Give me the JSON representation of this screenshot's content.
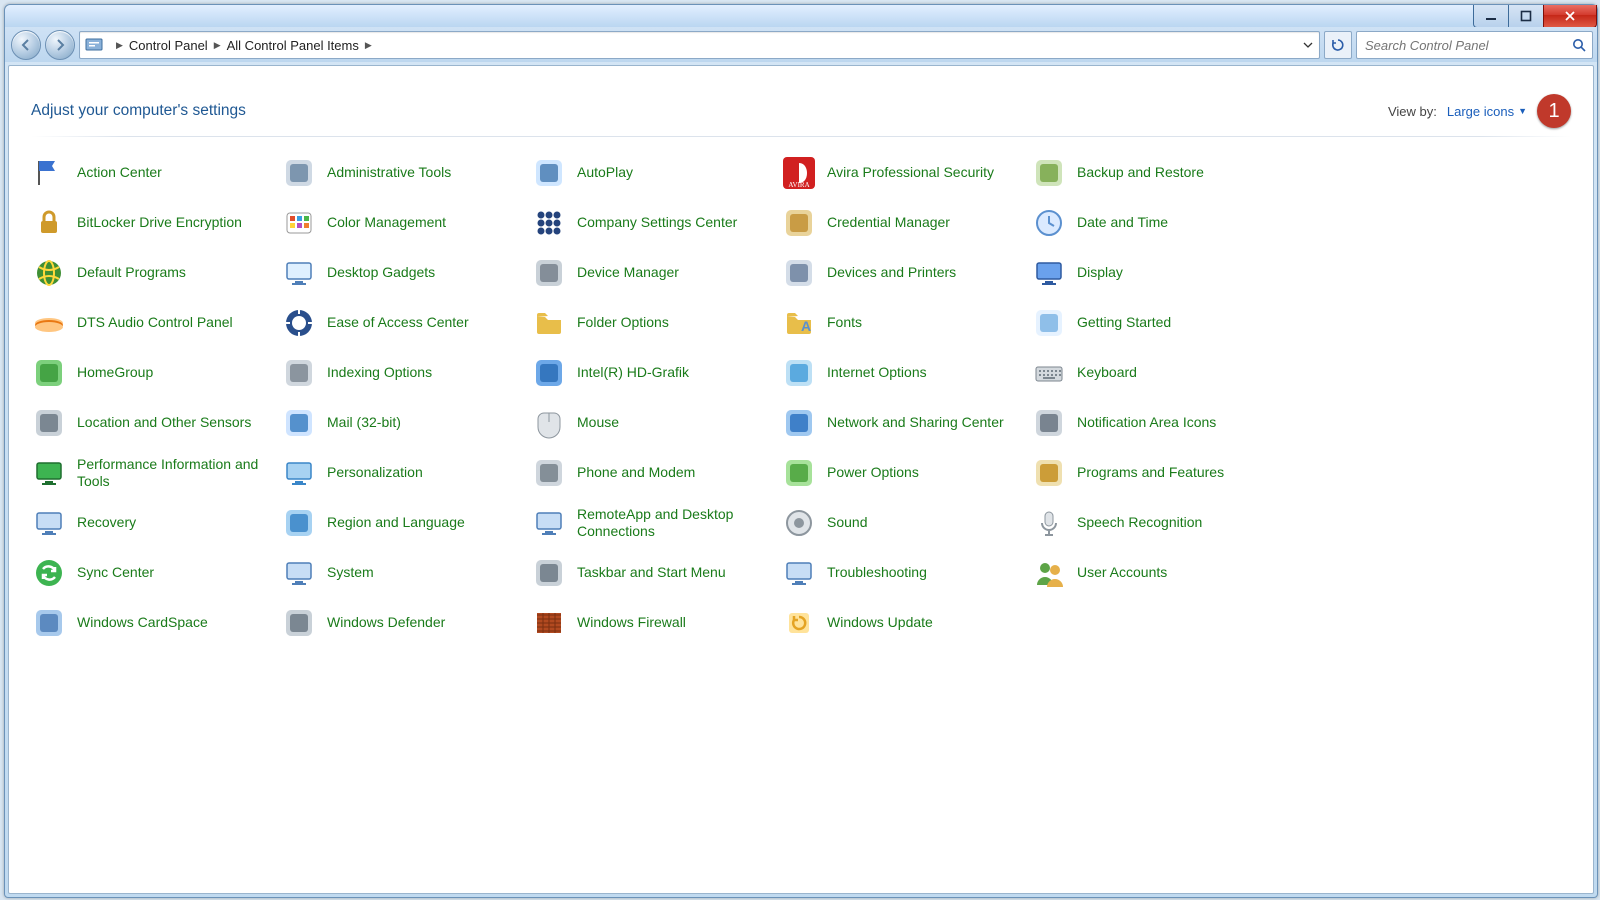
{
  "breadcrumb": {
    "root": "Control Panel",
    "sub": "All Control Panel Items"
  },
  "search": {
    "placeholder": "Search Control Panel"
  },
  "header": {
    "title": "Adjust your computer's settings",
    "viewby_label": "View by:",
    "viewby_value": "Large icons"
  },
  "annotation": {
    "label": "1"
  },
  "items": [
    {
      "label": "Action Center",
      "ic": "flag",
      "c1": "#3a72d0",
      "c2": "#6ba6ff"
    },
    {
      "label": "Administrative Tools",
      "ic": "tools",
      "c1": "#6f8aa6",
      "c2": "#cfd9e4"
    },
    {
      "label": "AutoPlay",
      "ic": "media",
      "c1": "#4c7fb5",
      "c2": "#cfe6ff"
    },
    {
      "label": "Avira Professional Security",
      "ic": "avira",
      "c1": "#d12020",
      "c2": "#ffffff"
    },
    {
      "label": "Backup and Restore",
      "ic": "backup",
      "c1": "#7aa84a",
      "c2": "#cfe4ba"
    },
    {
      "label": "BitLocker Drive Encryption",
      "ic": "lock",
      "c1": "#cf9a2b",
      "c2": "#ffe6a3"
    },
    {
      "label": "Color Management",
      "ic": "color",
      "c1": "#e24d2b",
      "c2": "#ffd43a"
    },
    {
      "label": "Company Settings Center",
      "ic": "dots",
      "c1": "#24437c",
      "c2": "#4b72c0"
    },
    {
      "label": "Credential Manager",
      "ic": "safe",
      "c1": "#c39236",
      "c2": "#e9d39a"
    },
    {
      "label": "Date and Time",
      "ic": "clock",
      "c1": "#5b90cf",
      "c2": "#dbeaff"
    },
    {
      "label": "Default Programs",
      "ic": "globe",
      "c1": "#3f8f34",
      "c2": "#ffd83b"
    },
    {
      "label": "Desktop Gadgets",
      "ic": "monitor",
      "c1": "#4f7fb8",
      "c2": "#dff0ff"
    },
    {
      "label": "Device Manager",
      "ic": "device",
      "c1": "#78838e",
      "c2": "#c9d1d8"
    },
    {
      "label": "Devices and Printers",
      "ic": "printer",
      "c1": "#6f84a0",
      "c2": "#d4dde8"
    },
    {
      "label": "Display",
      "ic": "screen",
      "c1": "#2e5aa0",
      "c2": "#6aa1ec"
    },
    {
      "label": "DTS Audio Control Panel",
      "ic": "dts",
      "c1": "#e97812",
      "c2": "#ffc681"
    },
    {
      "label": "Ease of Access Center",
      "ic": "ease",
      "c1": "#2a4f8c",
      "c2": "#6a9be5"
    },
    {
      "label": "Folder Options",
      "ic": "folder",
      "c1": "#e8be4a",
      "c2": "#fff0c0"
    },
    {
      "label": "Fonts",
      "ic": "fonts",
      "c1": "#e8be4a",
      "c2": "#5b90cf"
    },
    {
      "label": "Getting Started",
      "ic": "start",
      "c1": "#7fb6e5",
      "c2": "#e6f2ff"
    },
    {
      "label": "HomeGroup",
      "ic": "home",
      "c1": "#3c9c3c",
      "c2": "#7cd07c"
    },
    {
      "label": "Indexing Options",
      "ic": "index",
      "c1": "#7f8a94",
      "c2": "#d0d7de"
    },
    {
      "label": "Intel(R) HD-Grafik",
      "ic": "intel",
      "c1": "#2c6fb7",
      "c2": "#6da8e8"
    },
    {
      "label": "Internet Options",
      "ic": "netopt",
      "c1": "#4aa0da",
      "c2": "#bde0f5"
    },
    {
      "label": "Keyboard",
      "ic": "keyboard",
      "c1": "#7c868f",
      "c2": "#d4d9de"
    },
    {
      "label": "Location and Other Sensors",
      "ic": "sensor",
      "c1": "#6d7a86",
      "c2": "#c9d1d8"
    },
    {
      "label": "Mail (32-bit)",
      "ic": "mail",
      "c1": "#3f82c4",
      "c2": "#cfe4ff"
    },
    {
      "label": "Mouse",
      "ic": "mouse",
      "c1": "#8d969e",
      "c2": "#e0e4e8"
    },
    {
      "label": "Network and Sharing Center",
      "ic": "network",
      "c1": "#2e73c2",
      "c2": "#9fc8f0"
    },
    {
      "label": "Notification Area Icons",
      "ic": "notify",
      "c1": "#6a7582",
      "c2": "#cfd6dd"
    },
    {
      "label": "Performance Information and Tools",
      "ic": "perf",
      "c1": "#1e6f2f",
      "c2": "#3db451"
    },
    {
      "label": "Personalization",
      "ic": "pers",
      "c1": "#3a86c8",
      "c2": "#a7d2f2"
    },
    {
      "label": "Phone and Modem",
      "ic": "phone",
      "c1": "#77828c",
      "c2": "#cfd6dd"
    },
    {
      "label": "Power Options",
      "ic": "power",
      "c1": "#4aa23b",
      "c2": "#a7e29a"
    },
    {
      "label": "Programs and Features",
      "ic": "prog",
      "c1": "#c59023",
      "c2": "#efe0b0"
    },
    {
      "label": "Recovery",
      "ic": "recover",
      "c1": "#4f7fb8",
      "c2": "#c7ddf5"
    },
    {
      "label": "Region and Language",
      "ic": "region",
      "c1": "#3a86c8",
      "c2": "#a7d2f2"
    },
    {
      "label": "RemoteApp and Desktop Connections",
      "ic": "remote",
      "c1": "#4f7fb8",
      "c2": "#c7ddf5"
    },
    {
      "label": "Sound",
      "ic": "sound",
      "c1": "#8d969e",
      "c2": "#e0e4e8"
    },
    {
      "label": "Speech Recognition",
      "ic": "speech",
      "c1": "#8d969e",
      "c2": "#e0e4e8"
    },
    {
      "label": "Sync Center",
      "ic": "sync",
      "c1": "#3db451",
      "c2": "#a7e29a"
    },
    {
      "label": "System",
      "ic": "system",
      "c1": "#4f7fb8",
      "c2": "#c7ddf5"
    },
    {
      "label": "Taskbar and Start Menu",
      "ic": "taskbar",
      "c1": "#6d7a86",
      "c2": "#c9d1d8"
    },
    {
      "label": "Troubleshooting",
      "ic": "trouble",
      "c1": "#4f7fb8",
      "c2": "#c7ddf5"
    },
    {
      "label": "User Accounts",
      "ic": "users",
      "c1": "#5da447",
      "c2": "#e6b04a"
    },
    {
      "label": "Windows CardSpace",
      "ic": "card",
      "c1": "#4f7fb8",
      "c2": "#a7c9ec"
    },
    {
      "label": "Windows Defender",
      "ic": "defender",
      "c1": "#6d7a86",
      "c2": "#c9d1d8"
    },
    {
      "label": "Windows Firewall",
      "ic": "firewall",
      "c1": "#b24a20",
      "c2": "#e48a54"
    },
    {
      "label": "Windows Update",
      "ic": "update",
      "c1": "#e4a323",
      "c2": "#ffe39b"
    }
  ]
}
